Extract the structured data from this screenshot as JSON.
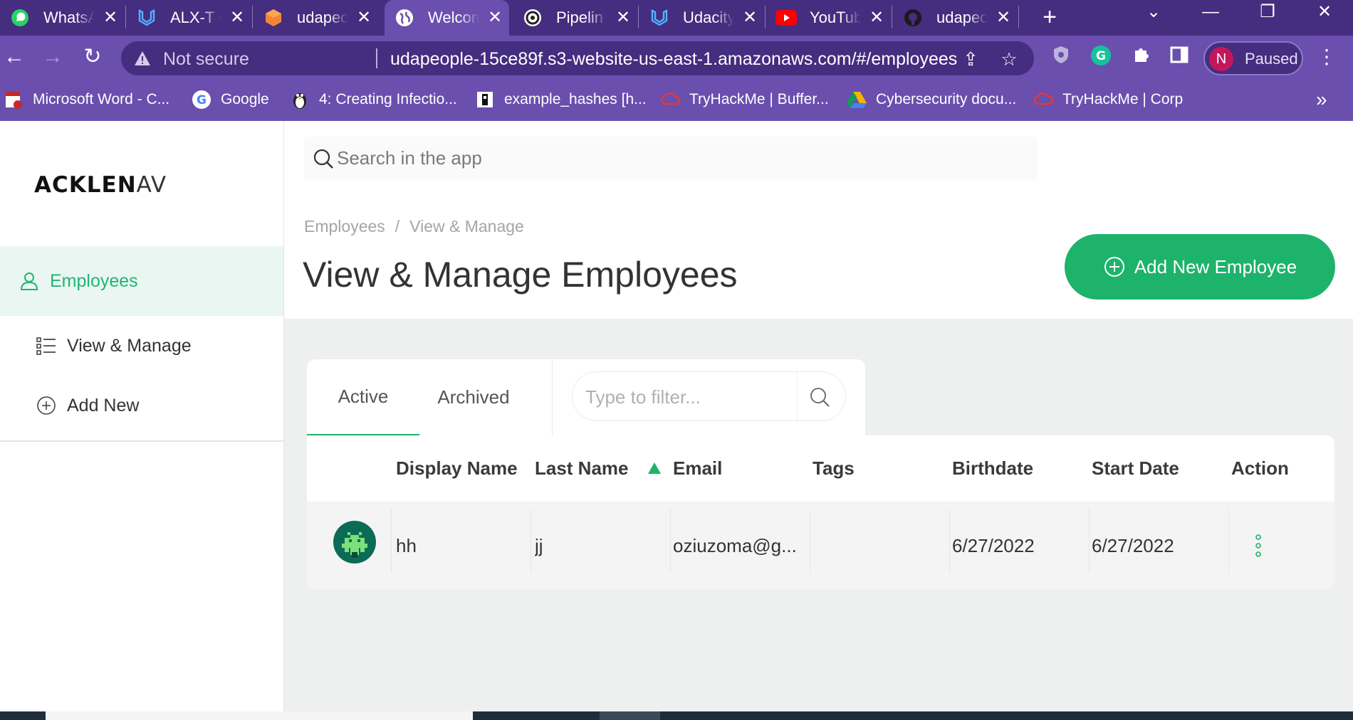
{
  "browser": {
    "tabs": [
      {
        "title": "WhatsA",
        "icon": "whatsapp-icon"
      },
      {
        "title": "ALX-T C",
        "icon": "udacity-icon"
      },
      {
        "title": "udapeo",
        "icon": "aws-icon"
      },
      {
        "title": "Welcom",
        "icon": "globe-icon"
      },
      {
        "title": "Pipelin",
        "icon": "circleci-icon"
      },
      {
        "title": "Udacity",
        "icon": "udacity-icon"
      },
      {
        "title": "YouTub",
        "icon": "youtube-icon"
      },
      {
        "title": "udapeo",
        "icon": "github-icon"
      }
    ],
    "active_tab_index": 3,
    "security_label": "Not secure",
    "url": "udapeople-15ce89f.s3-website-us-east-1.amazonaws.com/#/employees",
    "profile_initial": "N",
    "profile_status": "Paused",
    "bookmarks": [
      {
        "label": "Microsoft Word - C...",
        "icon": "word-doc-icon"
      },
      {
        "label": "Google",
        "icon": "google-icon"
      },
      {
        "label": "4: Creating Infectio...",
        "icon": "linux-penguin-icon"
      },
      {
        "label": "example_hashes [h...",
        "icon": "hashcat-icon"
      },
      {
        "label": "TryHackMe | Buffer...",
        "icon": "tryhackme-icon"
      },
      {
        "label": "Cybersecurity docu...",
        "icon": "google-drive-icon"
      },
      {
        "label": "TryHackMe | Corp",
        "icon": "tryhackme-icon"
      }
    ],
    "colors": {
      "chrome_dark": "#452d7f",
      "chrome_light": "#6a4fae"
    }
  },
  "app": {
    "logo_text_bold": "ACKLEN",
    "logo_text_faded": "AV",
    "search_placeholder": "Search in the app",
    "sidebar": {
      "items": [
        {
          "label": "Employees",
          "icon": "user-icon",
          "active": true
        },
        {
          "label": "View & Manage",
          "icon": "list-icon",
          "active": false
        },
        {
          "label": "Add New",
          "icon": "plus-circle-icon",
          "active": false
        }
      ]
    },
    "breadcrumb": [
      "Employees",
      "View & Manage"
    ],
    "breadcrumb_separator": "/",
    "page_title": "View & Manage Employees",
    "add_button_label": "Add New Employee",
    "tabs": {
      "active": "Active",
      "archived": "Archived"
    },
    "filter_placeholder": "Type to filter...",
    "table": {
      "columns": [
        "Display Name",
        "Last Name",
        "Email",
        "Tags",
        "Birthdate",
        "Start Date",
        "Action"
      ],
      "sorted_column": "Last Name",
      "sort_direction": "ascending",
      "rows": [
        {
          "display_name": "hh",
          "last_name": "jj",
          "email": "oziuzoma@g...",
          "tags": "",
          "birthdate": "6/27/2022",
          "start_date": "6/27/2022",
          "avatar": "space-invader-avatar"
        }
      ]
    },
    "colors": {
      "accent": "#1db36a",
      "active_nav_bg": "#eaf6f2",
      "content_bg": "#eef0ef"
    }
  }
}
